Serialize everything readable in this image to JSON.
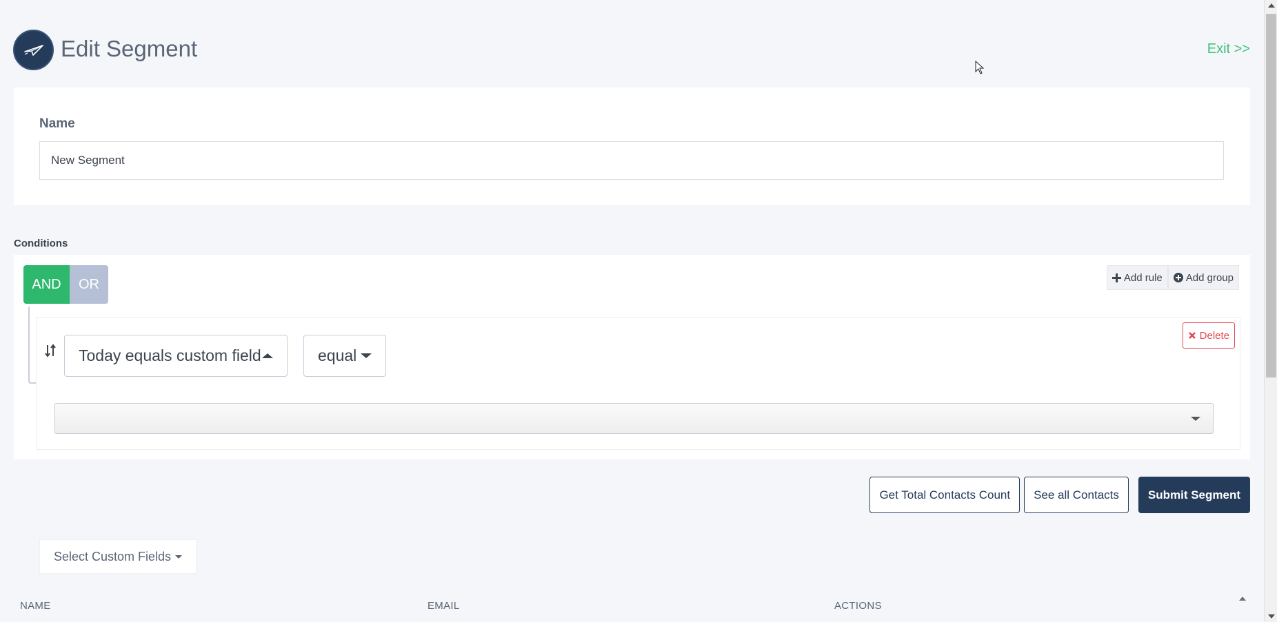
{
  "header": {
    "title": "Edit Segment",
    "exit_label": "Exit >>",
    "logo_icon": "paper-plane-icon"
  },
  "name_section": {
    "label": "Name",
    "value": "New Segment"
  },
  "conditions": {
    "label": "Conditions",
    "logic_and": "AND",
    "logic_or": "OR",
    "logic_selected": "AND",
    "add_rule": "Add rule",
    "add_group": "Add group",
    "rule": {
      "field": "Today equals custom field",
      "operator": "equal",
      "value": "",
      "delete_label": "Delete"
    }
  },
  "actions": {
    "total_count": "Get Total Contacts Count",
    "see_all": "See all Contacts",
    "submit": "Submit Segment"
  },
  "table": {
    "custom_fields_label": "Select Custom Fields",
    "columns": [
      "NAME",
      "EMAIL",
      "ACTIONS"
    ]
  },
  "colors": {
    "primary": "#243c5a",
    "success": "#2db86e",
    "danger": "#e5484d",
    "exit_link": "#3ec07a",
    "or_inactive": "#b5bfd6"
  }
}
